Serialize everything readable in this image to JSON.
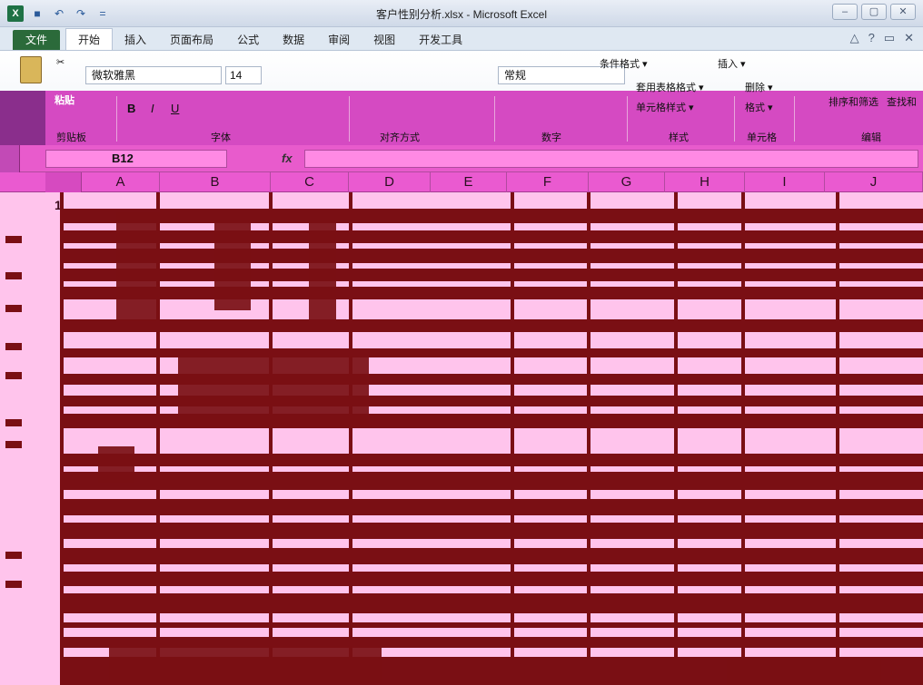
{
  "window": {
    "title": "客户性别分析.xlsx - Microsoft Excel",
    "buttons": [
      "–",
      "▢",
      "✕"
    ]
  },
  "qat": [
    "X",
    "💾",
    "↶",
    "↷",
    "="
  ],
  "tabs": [
    {
      "label": "文件",
      "kind": "file"
    },
    {
      "label": "开始",
      "kind": "active"
    },
    {
      "label": "插入"
    },
    {
      "label": "页面布局"
    },
    {
      "label": "公式"
    },
    {
      "label": "数据"
    },
    {
      "label": "审阅"
    },
    {
      "label": "视图"
    },
    {
      "label": "开发工具"
    }
  ],
  "ribbon": {
    "paste_label": "粘贴",
    "font_name": "微软雅黑",
    "font_size": "14",
    "number_format": "常规",
    "conditional_format": "条件格式 ▾",
    "table_format": "套用表格格式 ▾",
    "cell_style": "单元格样式 ▾",
    "insert": "插入 ▾",
    "delete": "删除 ▾",
    "format": "格式 ▾",
    "sort_filter": "排序和筛选",
    "find_select": "查找和",
    "groups": {
      "clipboard": "剪贴板",
      "font": "字体",
      "alignment": "对齐方式",
      "number": "数字",
      "styles": "样式",
      "cells": "单元格",
      "editing": "编辑"
    }
  },
  "formula_bar": {
    "name_box": "B12",
    "fx_label": "fx",
    "value": ""
  },
  "columns": [
    "A",
    "B",
    "C",
    "D",
    "E",
    "F",
    "G",
    "H",
    "I",
    "J"
  ],
  "row_labels": {
    "first": "1"
  },
  "colors": {
    "grid_pink": "#ffc4ec",
    "band_maroon": "#7a0f14",
    "ribbon_magenta": "#d54ac2"
  }
}
